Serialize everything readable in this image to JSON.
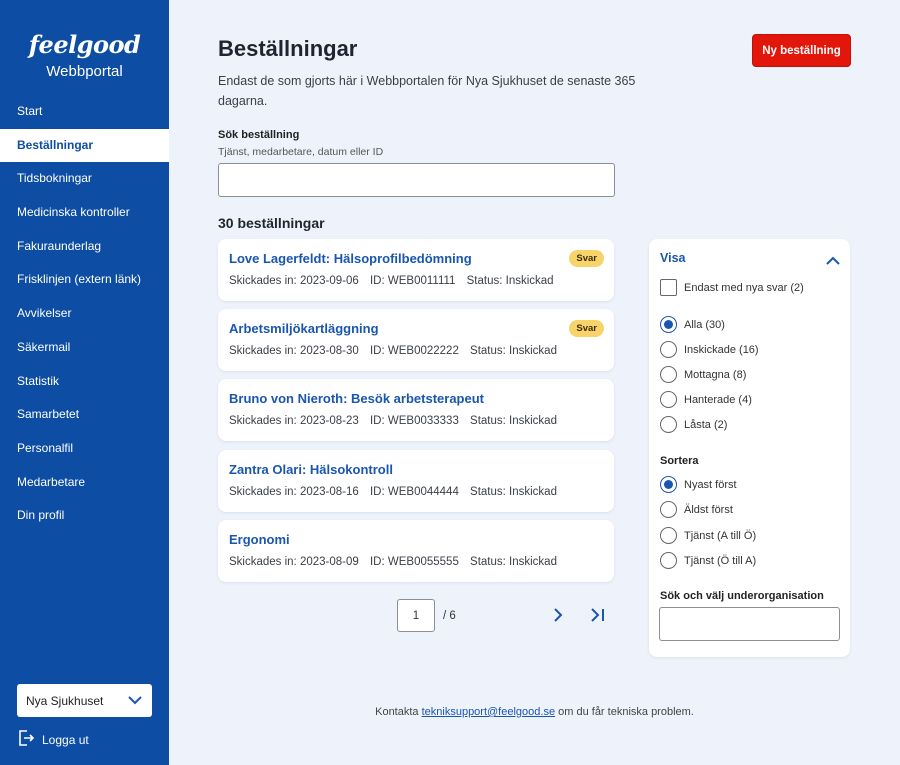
{
  "sidebar": {
    "logo": "feelgood",
    "portal_name": "Webbportal",
    "items": [
      {
        "label": "Start"
      },
      {
        "label": "Beställningar"
      },
      {
        "label": "Tidsbokningar"
      },
      {
        "label": "Medicinska kontroller"
      },
      {
        "label": "Fakuraunderlag"
      },
      {
        "label": "Frisklinjen (extern länk)"
      },
      {
        "label": "Avvikelser"
      },
      {
        "label": "Säkermail"
      },
      {
        "label": "Statistik"
      },
      {
        "label": "Samarbetet"
      },
      {
        "label": "Personalfil"
      },
      {
        "label": "Medarbetare"
      },
      {
        "label": "Din profil"
      }
    ],
    "active_index": 1,
    "organization": "Nya Sjukhuset",
    "logout_label": "Logga ut"
  },
  "header": {
    "title": "Beställningar",
    "new_button": "Ny beställning",
    "intro": "Endast de som gjorts här i Webbportalen för Nya Sjukhuset de senaste 365 dagarna."
  },
  "search": {
    "label": "Sök beställning",
    "hint": "Tjänst, medarbetare, datum eller ID",
    "value": ""
  },
  "results": {
    "count_label": "30 beställningar",
    "orders": [
      {
        "title": "Love Lagerfeldt: Hälsoprofilbedömning",
        "badge": "Svar",
        "sent": "Skickades in: 2023-09-06",
        "id": "ID: WEB0011111",
        "status": "Status: Inskickad"
      },
      {
        "title": "Arbetsmiljökartläggning",
        "badge": "Svar",
        "sent": "Skickades in: 2023-08-30",
        "id": "ID: WEB0022222",
        "status": "Status: Inskickad"
      },
      {
        "title": "Bruno von Nieroth: Besök arbetsterapeut",
        "badge": "",
        "sent": "Skickades in: 2023-08-23",
        "id": "ID: WEB0033333",
        "status": "Status: Inskickad"
      },
      {
        "title": "Zantra Olari: Hälsokontroll",
        "badge": "",
        "sent": "Skickades in: 2023-08-16",
        "id": "ID: WEB0044444",
        "status": "Status: Inskickad"
      },
      {
        "title": "Ergonomi",
        "badge": "",
        "sent": "Skickades in: 2023-08-09",
        "id": "ID: WEB0055555",
        "status": "Status: Inskickad"
      }
    ]
  },
  "pagination": {
    "current_page": "1",
    "total": "/ 6"
  },
  "filter": {
    "heading": "Visa",
    "only_new": "Endast med nya svar (2)",
    "show_options": [
      "Alla (30)",
      "Inskickade (16)",
      "Mottagna (8)",
      "Hanterade (4)",
      "Låsta (2)"
    ],
    "show_selected": 0,
    "sort_heading": "Sortera",
    "sort_options": [
      "Nyast först",
      "Äldst först",
      "Tjänst (A till Ö)",
      "Tjänst (Ö till A)"
    ],
    "sort_selected": 0,
    "org_search_label": "Sök och välj underorganisation",
    "org_search_value": ""
  },
  "footer": {
    "prefix": "Kontakta ",
    "email": "tekniksupport@feelgood.se",
    "suffix": " om du får tekniska problem."
  },
  "colors": {
    "sidebar": "#0d4da3",
    "accent": "#1a56b0",
    "primary_button": "#e3160b",
    "badge": "#f7d36a",
    "background": "#eef3fb"
  }
}
